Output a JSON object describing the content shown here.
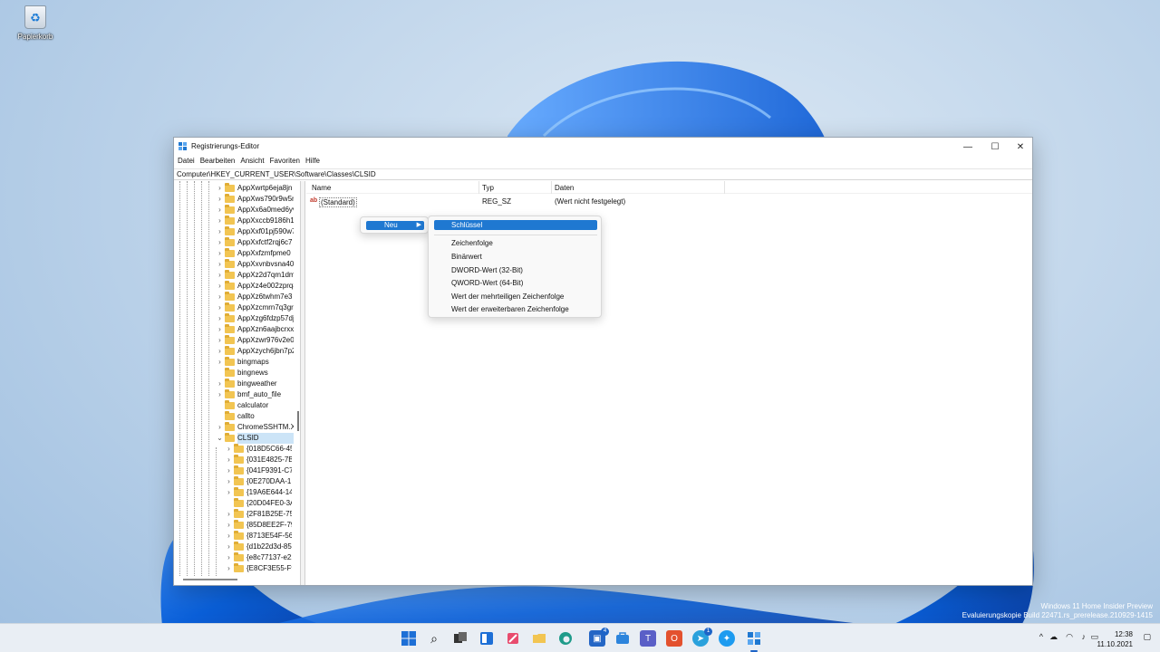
{
  "desktop": {
    "recycle_bin_label": "Papierkorb"
  },
  "window": {
    "title": "Registrierungs-Editor",
    "controls": {
      "minimize": "—",
      "maximize": "☐",
      "close": "✕"
    },
    "menu": [
      "Datei",
      "Bearbeiten",
      "Ansicht",
      "Favoriten",
      "Hilfe"
    ],
    "address": "Computer\\HKEY_CURRENT_USER\\Software\\Classes\\CLSID"
  },
  "tree": {
    "items": [
      "AppXwrtp6eja8jn",
      "AppXws790r9w5n",
      "AppXx6a0med6yv",
      "AppXxccb9186h1",
      "AppXxf01pj590w7",
      "AppXxfctf2rqj6c7",
      "AppXxfzmfpme0",
      "AppXxvnbvsna40",
      "AppXz2d7qm1dm",
      "AppXz4e002zprq8",
      "AppXz6twhm7e3",
      "AppXzcmrn7q3gr",
      "AppXzg6fdzp57dj",
      "AppXzn6aajbcrxx",
      "AppXzwr976v2e0",
      "AppXzych6jbn7p2",
      "bingmaps",
      "bingnews",
      "bingweather",
      "bmf_auto_file",
      "calculator",
      "callto",
      "ChromeSSHTM.X",
      "CLSID"
    ],
    "clsid_children": [
      "{018D5C66-45",
      "{031E4825-7B9",
      "{041F9391-C79",
      "{0E270DAA-1B",
      "{19A6E644-14E",
      "{20D04FE0-3AE",
      "{2F81B25E-750",
      "{85D8EE2F-794",
      "{8713E54F-56B",
      "{d1b22d3d-85",
      "{e8c77137-e22",
      "{E8CF3E55-F91"
    ]
  },
  "list": {
    "columns": [
      "Name",
      "Typ",
      "Daten"
    ],
    "rows": [
      {
        "icon": "ab",
        "name": "(Standard)",
        "type": "REG_SZ",
        "data": "(Wert nicht festgelegt)"
      }
    ]
  },
  "context_menu": {
    "parent": "Neu",
    "items": [
      "Schlüssel",
      "Zeichenfolge",
      "Binärwert",
      "DWORD-Wert (32-Bit)",
      "QWORD-Wert (64-Bit)",
      "Wert der mehrteiligen Zeichenfolge",
      "Wert der erweiterbaren Zeichenfolge"
    ]
  },
  "watermark": {
    "line1": "Windows 11 Home Insider Preview",
    "line2": "Evaluierungskopie Build 22471.rs_prerelease.210929-1415"
  },
  "taskbar": {
    "badges": {
      "store": "4",
      "telegram": "1"
    },
    "clock": {
      "time": "12:38",
      "date": "11.10.2021"
    },
    "accent": "#1d64c7"
  }
}
